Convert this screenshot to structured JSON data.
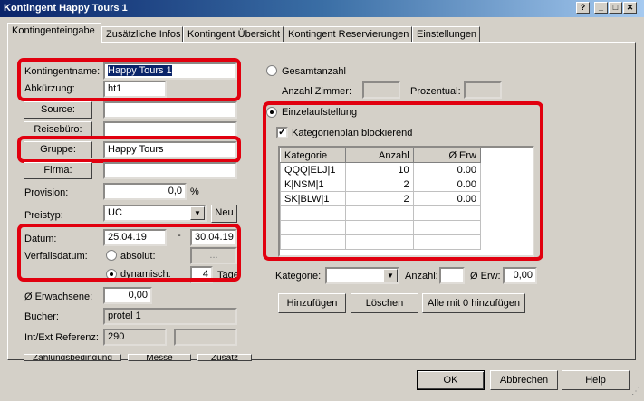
{
  "window": {
    "title": "Kontingent Happy Tours 1"
  },
  "tabs": [
    "Kontingenteingabe",
    "Zusätzliche Infos",
    "Kontingent Übersicht",
    "Kontingent Reservierungen",
    "Einstellungen"
  ],
  "left": {
    "name_label": "Kontingentname:",
    "name_value": "Happy Tours 1",
    "abbr_label": "Abkürzung:",
    "abbr_value": "ht1",
    "source_btn": "Source:",
    "reisebuero_btn": "Reisebüro:",
    "gruppe_btn": "Gruppe:",
    "gruppe_value": "Happy Tours",
    "firma_btn": "Firma:",
    "provision_label": "Provision:",
    "provision_value": "0,0",
    "provision_unit": "%",
    "preistyp_label": "Preistyp:",
    "preistyp_value": "UC",
    "neu_btn": "Neu",
    "datum_label": "Datum:",
    "datum_from": "25.04.19",
    "datum_sep": "-",
    "datum_to": "30.04.19",
    "verfall_label": "Verfallsdatum:",
    "absolut_label": "absolut:",
    "absolut_btn": "...",
    "dynamisch_label": "dynamisch:",
    "dynamisch_value": "4",
    "tage_label": "Tage",
    "erwachsene_label": "Ø Erwachsene:",
    "erwachsene_value": "0,00",
    "bucher_label": "Bucher:",
    "bucher_value": "protel 1",
    "ref_label": "Int/Ext Referenz:",
    "ref_value": "290",
    "bottom_btns": [
      "Zahlungsbedingung",
      "Messe",
      "Zusatz"
    ]
  },
  "right": {
    "gesamt_label": "Gesamtanzahl",
    "anzahl_zimmer_label": "Anzahl Zimmer:",
    "prozentual_label": "Prozentual:",
    "einzel_label": "Einzelaufstellung",
    "blockierend_label": "Kategorienplan blockierend",
    "table": {
      "headers": [
        "Kategorie",
        "Anzahl",
        "Ø Erw"
      ],
      "rows": [
        [
          "QQQ|ELJ|1",
          "10",
          "0.00"
        ],
        [
          "K|NSM|1",
          "2",
          "0.00"
        ],
        [
          "SK|BLW|1",
          "2",
          "0.00"
        ]
      ]
    },
    "kategorie_label": "Kategorie:",
    "anzahl_label": "Anzahl:",
    "erw_label": "Ø Erw:",
    "erw_value": "0,00",
    "hinzufuegen_btn": "Hinzufügen",
    "loeschen_btn": "Löschen",
    "alle_btn": "Alle mit 0 hinzufügen"
  },
  "footer": {
    "ok": "OK",
    "cancel": "Abbrechen",
    "help": "Help"
  },
  "colors": {
    "highlight": "#e1000f",
    "titlebar": "#0a246a"
  }
}
